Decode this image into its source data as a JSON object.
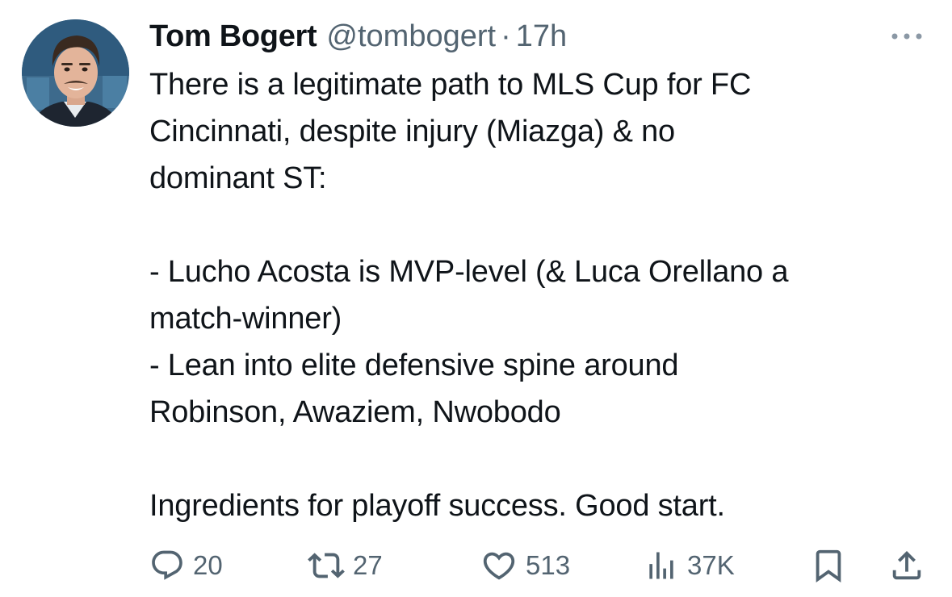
{
  "tweet": {
    "author_name": "Tom Bogert",
    "handle": "@tombogert",
    "separator": "·",
    "time": "17h",
    "text_lines": [
      "There is a legitimate path to MLS Cup for FC",
      "Cincinnati, despite injury (Miazga) & no",
      "dominant ST:",
      "",
      "- Lucho Acosta is MVP-level (& Luca Orellano a",
      "match-winner)",
      "- Lean into elite defensive spine around",
      "Robinson, Awaziem, Nwobodo",
      "",
      "Ingredients for playoff success. Good start."
    ]
  },
  "actions": {
    "reply": {
      "icon": "reply-icon",
      "count": "20"
    },
    "repost": {
      "icon": "repost-icon",
      "count": "27"
    },
    "like": {
      "icon": "heart-icon",
      "count": "513"
    },
    "views": {
      "icon": "views-chart-icon",
      "count": "37K"
    },
    "bookmark": {
      "icon": "bookmark-icon"
    },
    "share": {
      "icon": "share-icon"
    }
  },
  "colors": {
    "text_primary": "#0f1419",
    "text_secondary": "#536471",
    "background": "#ffffff"
  }
}
